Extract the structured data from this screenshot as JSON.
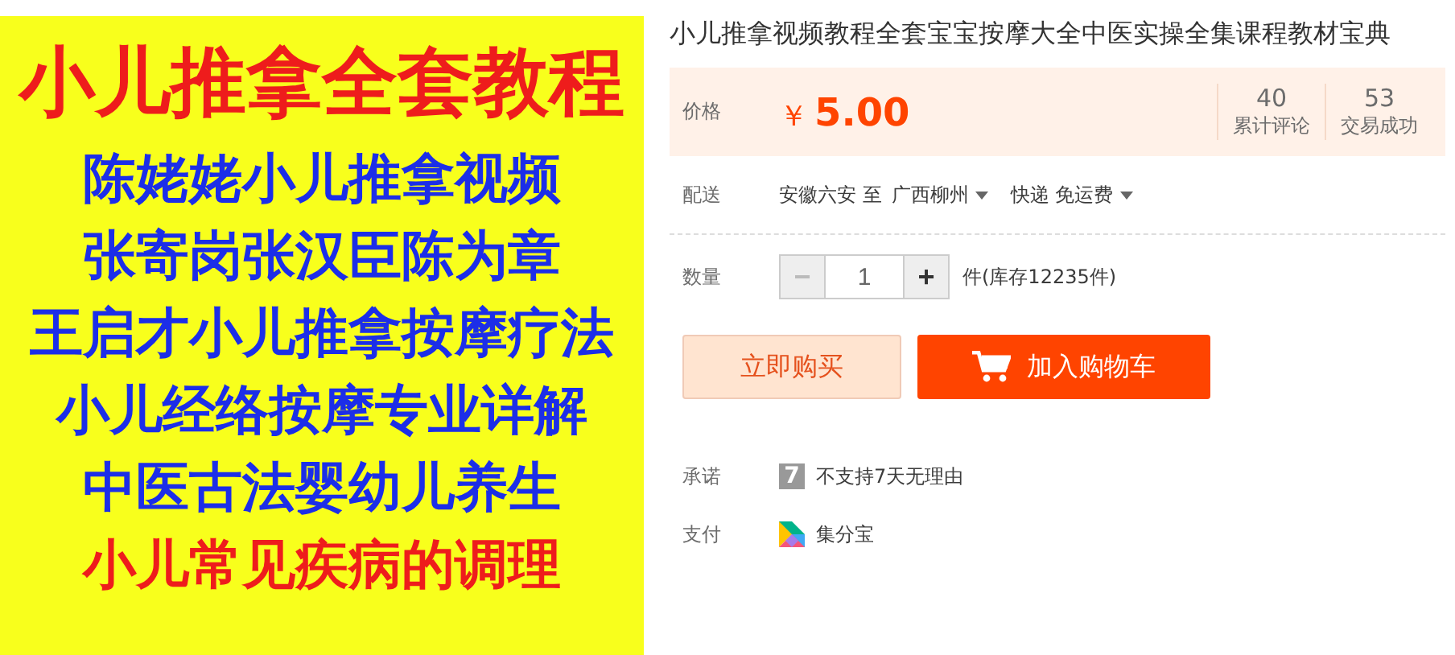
{
  "poster": {
    "lines": [
      {
        "text": "小儿推拿全套教程",
        "color": "#ee1c1c",
        "kind": "headline"
      },
      {
        "text": "陈姥姥小儿推拿视频",
        "color": "#1c2ee8",
        "kind": "normal"
      },
      {
        "text": "张寄岗张汉臣陈为章",
        "color": "#1c2ee8",
        "kind": "normal"
      },
      {
        "text": "王启才小儿推拿按摩疗法",
        "color": "#1c2ee8",
        "kind": "normal"
      },
      {
        "text": "小儿经络按摩专业详解",
        "color": "#1c2ee8",
        "kind": "normal"
      },
      {
        "text": "中医古法婴幼儿养生",
        "color": "#1c2ee8",
        "kind": "normal"
      },
      {
        "text": "小儿常见疾病的调理",
        "color": "#ee1c1c",
        "kind": "normal"
      }
    ]
  },
  "product": {
    "title": "小儿推拿视频教程全套宝宝按摩大全中医实操全集课程教材宝典",
    "price": {
      "label": "价格",
      "currency": "￥",
      "amount": "5.00",
      "stats": [
        {
          "value": "40",
          "label": "累计评论"
        },
        {
          "value": "53",
          "label": "交易成功"
        }
      ]
    },
    "delivery": {
      "label": "配送",
      "from": "安徽六安 至",
      "to": "广西柳州",
      "shipping": "快递 免运费"
    },
    "quantity": {
      "label": "数量",
      "minus": "−",
      "value": "1",
      "plus": "+",
      "stock": "件(库存12235件)"
    },
    "buttons": [
      {
        "text": "立即购买",
        "kind": "buy"
      },
      {
        "text": "加入购物车",
        "kind": "cart"
      }
    ],
    "promise": {
      "label": "承诺",
      "badge": "7",
      "text": "不支持7天无理由"
    },
    "payment": {
      "label": "支付",
      "text": "集分宝"
    }
  }
}
